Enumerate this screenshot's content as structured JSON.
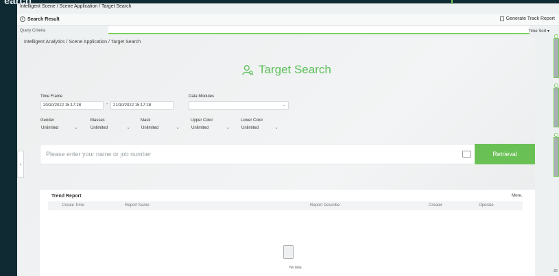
{
  "corner_text": "earch",
  "back": {
    "breadcrumb": "Intelligent Scene / Scene Application / Target Search",
    "title": "Search Result",
    "generate_report": "Generate Track Report",
    "query_criteria": "Query Criteria",
    "time_sort": "Time Sort",
    "footer_num": "-25"
  },
  "front": {
    "breadcrumb": "Intelligent Analytics / Scene Application / Target Search",
    "heading": "Target Search",
    "accent": "#69c155",
    "time_frame": {
      "label": "Time Frame",
      "start": "20/10/2022 15:17:28",
      "separator": "-",
      "end": "21/10/2022 15:17:28"
    },
    "data_modules": {
      "label": "Data Modules",
      "value": ""
    },
    "filters": [
      {
        "label": "Gender",
        "value": "Unlimited"
      },
      {
        "label": "Glasses",
        "value": "Unlimited"
      },
      {
        "label": "Mask",
        "value": "Unlimited"
      },
      {
        "label": "Upper Color",
        "value": "Unlimited"
      },
      {
        "label": "Lower Color",
        "value": "Unlimited"
      }
    ],
    "search": {
      "placeholder": "Please enter your name or job number",
      "button": "Retrieval"
    },
    "trend": {
      "title": "Trend Report",
      "more": "More..",
      "columns": [
        "Create Time",
        "Report Name",
        "Report Describe",
        "Creater",
        "Operate"
      ],
      "empty": "No data"
    }
  }
}
